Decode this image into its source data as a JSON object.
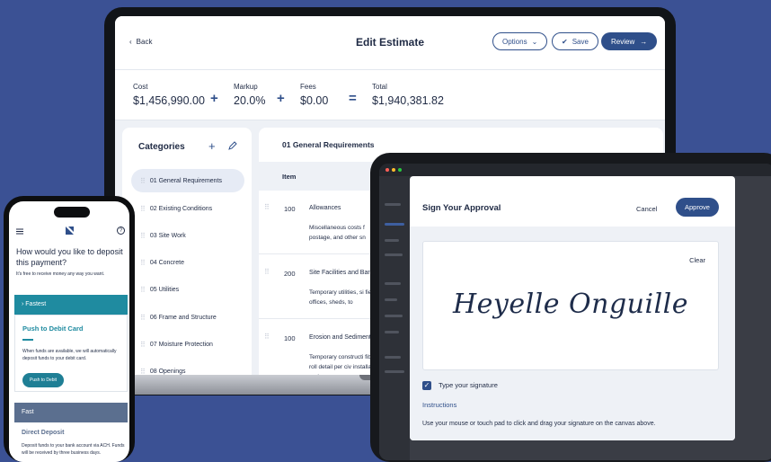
{
  "estimate": {
    "back_label": "Back",
    "title": "Edit Estimate",
    "options_label": "Options",
    "save_label": "Save",
    "review_label": "Review",
    "cost_label": "Cost",
    "cost_value": "$1,456,990.00",
    "markup_label": "Markup",
    "markup_value": "20.0%",
    "fees_label": "Fees",
    "fees_value": "$0.00",
    "total_label": "Total",
    "total_value": "$1,940,381.82",
    "op_plus": "+",
    "op_equals": "="
  },
  "categories": {
    "title": "Categories",
    "items": [
      {
        "label": "01  General Requirements"
      },
      {
        "label": "02  Existing Conditions"
      },
      {
        "label": "03  Site Work"
      },
      {
        "label": "04  Concrete"
      },
      {
        "label": "05  Utilities"
      },
      {
        "label": "06  Frame and Structure"
      },
      {
        "label": "07  Moisture Protection"
      },
      {
        "label": "08  Openings"
      }
    ]
  },
  "items": {
    "section_title": "01 General Requirements",
    "col_item": "Item",
    "rows": [
      {
        "num": "100",
        "name": "Allowances",
        "desc": "Miscellaneous costs f postage, and other sn"
      },
      {
        "num": "200",
        "name": "Site Facilities and Bar",
        "desc": "Temporary utilities, si field offices, sheds, to"
      },
      {
        "num": "100",
        "name": "Erosion and Sediment",
        "desc": "Temporary constructi fiber roll detail per civ installation and remov"
      }
    ]
  },
  "approval": {
    "title": "Sign Your Approval",
    "cancel_label": "Cancel",
    "approve_label": "Approve",
    "clear_label": "Clear",
    "signature": "Heyelle Onguille",
    "type_sig_label": "Type your signature",
    "instructions_title": "Instructions",
    "instructions_text": "Use your mouse or touch pad to click and drag your signature on the canvas above."
  },
  "phone": {
    "question": "How would you like to deposit this payment?",
    "subtitle": "It's free to receive money any way you want.",
    "fastest_label": "Fastest",
    "push_title": "Push to Debit Card",
    "push_text": "When funds are available, we will automatically deposit funds to your debit card.",
    "push_button": "Push to Debit",
    "fast_label": "Fast",
    "direct_title": "Direct Deposit",
    "direct_text": "Deposit funds to your bank account via ACH. Funds will be received by three business days."
  },
  "colors": {
    "background": "#3b5194",
    "primary": "#2f4f8a",
    "teal": "#1f8ba0"
  }
}
